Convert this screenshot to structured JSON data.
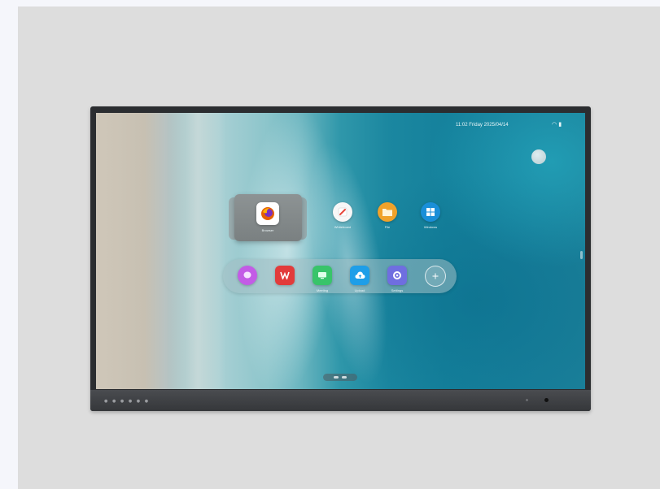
{
  "status_bar": {
    "datetime": "11:02 Friday 2025/04/14"
  },
  "home_screen": {
    "folder_app": {
      "label": "Browser",
      "icon": "firefox-icon",
      "color": "#e66000"
    },
    "grid_apps": [
      {
        "label": "Whiteboard",
        "icon": "pen-icon",
        "color": "#e7473c"
      },
      {
        "label": "File",
        "icon": "folder-icon",
        "color": "#f0a22a"
      },
      {
        "label": "Windows",
        "icon": "windows-icon",
        "color": "#1a8fd8"
      }
    ],
    "dock_apps": [
      {
        "label": "",
        "icon": "chat-bubble-icon",
        "color": "#c35ce6"
      },
      {
        "label": "",
        "icon": "wps-icon",
        "color": "#e23b3b"
      },
      {
        "label": "Meeting",
        "icon": "screen-icon",
        "color": "#38c46a"
      },
      {
        "label": "Upload",
        "icon": "cloud-upload-icon",
        "color": "#1e9ee8"
      },
      {
        "label": "Settings",
        "icon": "settings-icon",
        "color": "#6f6ee0"
      }
    ],
    "add_button": {
      "icon": "plus-icon"
    }
  }
}
